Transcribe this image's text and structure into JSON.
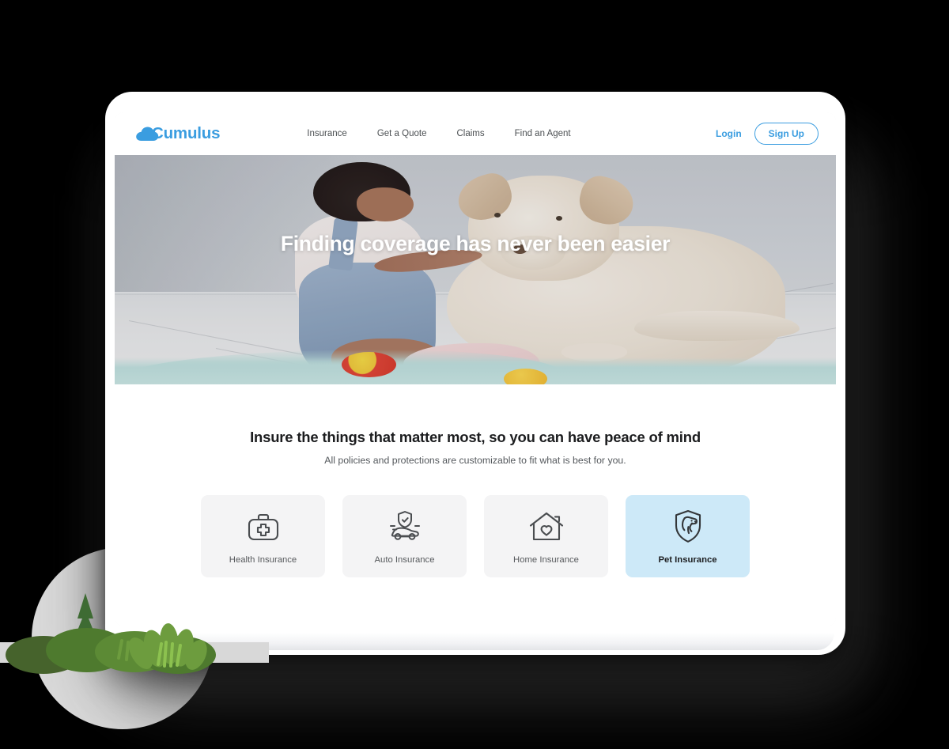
{
  "brand": {
    "name": "Cumulus",
    "logo_icon": "cloud-icon",
    "color": "#3a9de0"
  },
  "nav": {
    "links": [
      {
        "label": "Insurance"
      },
      {
        "label": "Get a Quote"
      },
      {
        "label": "Claims"
      },
      {
        "label": "Find an Agent"
      }
    ],
    "login_label": "Login",
    "signup_label": "Sign Up"
  },
  "hero": {
    "headline": "Finding coverage has never been easier",
    "image_description": "toddler petting a cream colored dog on a light wood floor"
  },
  "promo": {
    "title": "Insure the things that matter most, so you can have peace of mind",
    "subtitle": "All policies and protections are customizable to fit what is best for you."
  },
  "categories": [
    {
      "label": "Health Insurance",
      "icon": "medical-bag-icon",
      "selected": false
    },
    {
      "label": "Auto Insurance",
      "icon": "car-shield-icon",
      "selected": false
    },
    {
      "label": "Home Insurance",
      "icon": "house-heart-icon",
      "selected": false
    },
    {
      "label": "Pet Insurance",
      "icon": "dog-shield-icon",
      "selected": true
    }
  ],
  "colors": {
    "accent": "#3a9de0",
    "card_default_bg": "#f4f4f5",
    "card_selected_bg": "#cde9f8",
    "icon_stroke": "#4a4d50",
    "backdrop": "#000000"
  }
}
